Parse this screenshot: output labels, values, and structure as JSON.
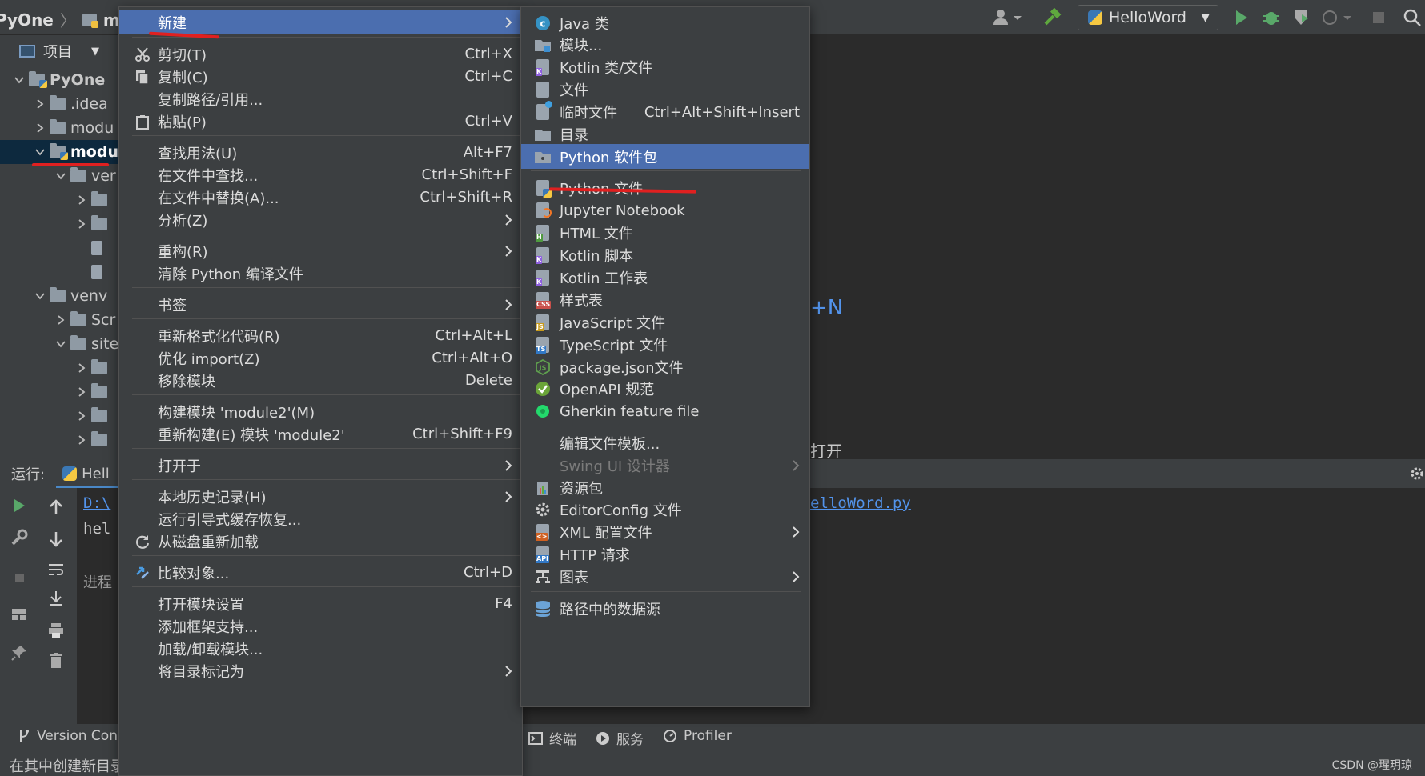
{
  "app": {
    "breadcrumb": [
      "PyOne",
      "modu"
    ],
    "run_config": "HelloWord",
    "watermark": "CSDN @瑆玥琼"
  },
  "project": {
    "tab_label": "项目",
    "tree": [
      {
        "label": "PyOne",
        "indent": 0,
        "expanded": true,
        "bold": true,
        "type": "project"
      },
      {
        "label": ".idea",
        "indent": 1,
        "expanded": false,
        "type": "folder"
      },
      {
        "label": "modu",
        "indent": 1,
        "expanded": false,
        "type": "folder"
      },
      {
        "label": "modu",
        "indent": 1,
        "expanded": true,
        "type": "module",
        "selected": true
      },
      {
        "label": "ver",
        "indent": 2,
        "expanded": true,
        "type": "folder"
      },
      {
        "label": "",
        "indent": 3,
        "expanded": false,
        "type": "folder"
      },
      {
        "label": "",
        "indent": 3,
        "expanded": false,
        "type": "folder"
      },
      {
        "label": "",
        "indent": 3,
        "expanded": null,
        "type": "file"
      },
      {
        "label": "",
        "indent": 3,
        "expanded": null,
        "type": "file"
      },
      {
        "label": "venv",
        "indent": 1,
        "expanded": true,
        "type": "folder"
      },
      {
        "label": "Scr",
        "indent": 2,
        "expanded": false,
        "type": "folder"
      },
      {
        "label": "site",
        "indent": 2,
        "expanded": true,
        "type": "folder"
      },
      {
        "label": "",
        "indent": 3,
        "expanded": false,
        "type": "folder"
      },
      {
        "label": "",
        "indent": 3,
        "expanded": false,
        "type": "folder"
      },
      {
        "label": "",
        "indent": 3,
        "expanded": false,
        "type": "folder"
      },
      {
        "label": "",
        "indent": 3,
        "expanded": false,
        "type": "folder"
      }
    ]
  },
  "run_panel": {
    "label": "运行:",
    "tab": "Hell",
    "console_lines": [
      "D:\\",
      "hel",
      "",
      "进程"
    ]
  },
  "editor": {
    "hint_shortcut": "+N",
    "hint_open": "打开",
    "run_link": "elloWord.py"
  },
  "bottom_tabs": [
    {
      "label": "Version Cont",
      "icon": "branch-icon"
    },
    {
      "label": "终端",
      "icon": "terminal-icon"
    },
    {
      "label": "服务",
      "icon": "services-icon"
    },
    {
      "label": "Profiler",
      "icon": "profiler-icon"
    }
  ],
  "status_text": "在其中创建新目录",
  "context_menu": {
    "items": [
      {
        "label": "新建",
        "shortcut": "",
        "submenu": true,
        "highlight": true,
        "icon": ""
      },
      {
        "sep": true
      },
      {
        "label": "剪切(T)",
        "shortcut": "Ctrl+X",
        "icon": "scissors-icon"
      },
      {
        "label": "复制(C)",
        "shortcut": "Ctrl+C",
        "icon": "copy-icon"
      },
      {
        "label": "复制路径/引用...",
        "shortcut": ""
      },
      {
        "label": "粘贴(P)",
        "shortcut": "Ctrl+V",
        "icon": "paste-icon"
      },
      {
        "sep": true
      },
      {
        "label": "查找用法(U)",
        "shortcut": "Alt+F7"
      },
      {
        "label": "在文件中查找...",
        "shortcut": "Ctrl+Shift+F"
      },
      {
        "label": "在文件中替换(A)...",
        "shortcut": "Ctrl+Shift+R"
      },
      {
        "label": "分析(Z)",
        "submenu": true
      },
      {
        "sep": true
      },
      {
        "label": "重构(R)",
        "submenu": true
      },
      {
        "label": "清除 Python 编译文件",
        "shortcut": ""
      },
      {
        "sep": true
      },
      {
        "label": "书签",
        "submenu": true
      },
      {
        "sep": true
      },
      {
        "label": "重新格式化代码(R)",
        "shortcut": "Ctrl+Alt+L"
      },
      {
        "label": "优化 import(Z)",
        "shortcut": "Ctrl+Alt+O"
      },
      {
        "label": "移除模块",
        "shortcut": "Delete"
      },
      {
        "sep": true
      },
      {
        "label": "构建模块 'module2'(M)",
        "shortcut": ""
      },
      {
        "label": "重新构建(E) 模块 'module2'",
        "shortcut": "Ctrl+Shift+F9"
      },
      {
        "sep": true
      },
      {
        "label": "打开于",
        "submenu": true
      },
      {
        "sep": true
      },
      {
        "label": "本地历史记录(H)",
        "submenu": true
      },
      {
        "label": "运行引导式缓存恢复...",
        "shortcut": ""
      },
      {
        "label": "从磁盘重新加载",
        "shortcut": "",
        "icon": "reload-icon"
      },
      {
        "sep": true
      },
      {
        "label": "比较对象...",
        "shortcut": "Ctrl+D",
        "icon": "compare-icon"
      },
      {
        "sep": true
      },
      {
        "label": "打开模块设置",
        "shortcut": "F4"
      },
      {
        "label": "添加框架支持...",
        "shortcut": ""
      },
      {
        "label": "加载/卸载模块...",
        "shortcut": ""
      },
      {
        "label": "将目录标记为",
        "submenu": true
      }
    ]
  },
  "new_submenu": {
    "items": [
      {
        "label": "Java 类",
        "icon": "java-class-icon"
      },
      {
        "label": "模块...",
        "icon": "module-icon"
      },
      {
        "label": "Kotlin 类/文件",
        "icon": "kotlin-file-icon"
      },
      {
        "label": "文件",
        "icon": "file-icon"
      },
      {
        "label": "临时文件",
        "shortcut": "Ctrl+Alt+Shift+Insert",
        "icon": "scratch-file-icon"
      },
      {
        "label": "目录",
        "icon": "folder-icon"
      },
      {
        "label": "Python 软件包",
        "icon": "package-icon",
        "highlight": true
      },
      {
        "sep": true
      },
      {
        "label": "Python 文件",
        "icon": "python-file-icon"
      },
      {
        "label": "Jupyter Notebook",
        "icon": "jupyter-icon"
      },
      {
        "label": "HTML 文件",
        "icon": "html-file-icon"
      },
      {
        "label": "Kotlin 脚本",
        "icon": "kotlin-script-icon"
      },
      {
        "label": "Kotlin 工作表",
        "icon": "kotlin-worksheet-icon"
      },
      {
        "label": "样式表",
        "icon": "css-file-icon"
      },
      {
        "label": "JavaScript 文件",
        "icon": "js-file-icon"
      },
      {
        "label": "TypeScript 文件",
        "icon": "ts-file-icon"
      },
      {
        "label": "package.json文件",
        "icon": "nodejs-icon"
      },
      {
        "label": "OpenAPI 规范",
        "icon": "openapi-icon"
      },
      {
        "label": "Gherkin feature file",
        "icon": "gherkin-icon"
      },
      {
        "sep": true
      },
      {
        "label": "编辑文件模板...",
        "icon": ""
      },
      {
        "label": "Swing UI 设计器",
        "disabled": true,
        "submenu": true
      },
      {
        "label": "资源包",
        "icon": "resource-bundle-icon"
      },
      {
        "label": "EditorConfig 文件",
        "icon": "gear-icon"
      },
      {
        "label": "XML 配置文件",
        "icon": "xml-file-icon",
        "submenu": true
      },
      {
        "label": "HTTP 请求",
        "icon": "api-icon"
      },
      {
        "label": "图表",
        "icon": "diagram-icon",
        "submenu": true
      },
      {
        "sep": true
      },
      {
        "label": "路径中的数据源",
        "icon": "datasource-icon"
      }
    ]
  },
  "colors": {
    "menu_bg": "#3c3f41",
    "highlight": "#4b6eaf",
    "annotation": "#e02020",
    "tree_selected": "#0d293e"
  }
}
